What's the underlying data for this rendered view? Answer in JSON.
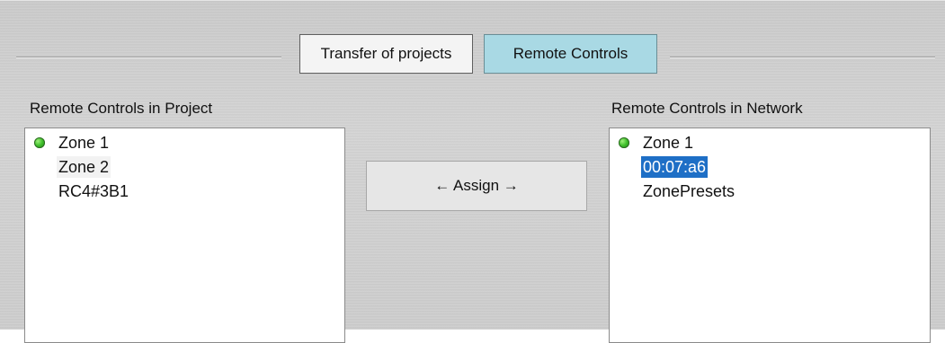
{
  "tabs": {
    "transfer_label": "Transfer of projects",
    "remote_label": "Remote Controls"
  },
  "left_panel": {
    "title": "Remote Controls in Project",
    "items": [
      {
        "label": "Zone 1",
        "status": "online"
      },
      {
        "label": "Zone 2"
      },
      {
        "label": "RC4#3B1"
      }
    ]
  },
  "right_panel": {
    "title": "Remote Controls in Network",
    "items": [
      {
        "label": "Zone 1",
        "status": "online"
      },
      {
        "label": "00:07:a6",
        "selected": true
      },
      {
        "label": "ZonePresets"
      }
    ]
  },
  "assign_button": {
    "label": "← Assign →"
  },
  "colors": {
    "tab_active": "#a9d9e4",
    "selection": "#1e6fc6",
    "status_online": "#3fbf2b"
  },
  "icons": {
    "status": "green-status-dot-icon"
  }
}
